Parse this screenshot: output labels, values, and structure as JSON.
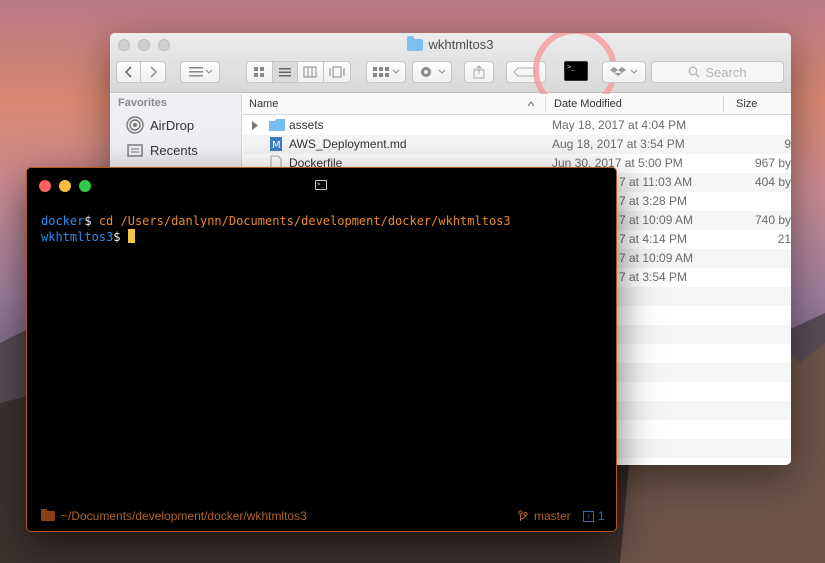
{
  "finder": {
    "title": "wkhtmltos3",
    "search_placeholder": "Search",
    "sidebar": {
      "heading": "Favorites",
      "items": [
        {
          "label": "AirDrop",
          "icon": "airdrop-icon"
        },
        {
          "label": "Recents",
          "icon": "recents-icon"
        }
      ]
    },
    "columns": {
      "name": "Name",
      "date": "Date Modified",
      "size": "Size"
    },
    "rows": [
      {
        "name": "assets",
        "date": "May 18, 2017 at 4:04 PM",
        "size": ""
      },
      {
        "name": "AWS_Deployment.md",
        "date": "Aug 18, 2017 at 3:54 PM",
        "size": "9"
      },
      {
        "name": "Dockerfile",
        "date": "Jun 30, 2017 at 5:00 PM",
        "size": "967 by"
      },
      {
        "name": "",
        "date": "7 at 11:03 AM",
        "size": "404 by"
      },
      {
        "name": "",
        "date": "7 at 3:28 PM",
        "size": ""
      },
      {
        "name": "",
        "date": "7 at 10:09 AM",
        "size": "740 by"
      },
      {
        "name": "",
        "date": "7 at 4:14 PM",
        "size": "21"
      },
      {
        "name": "",
        "date": "7 at 10:09 AM",
        "size": ""
      },
      {
        "name": "",
        "date": "7 at 3:54 PM",
        "size": ""
      }
    ]
  },
  "terminal": {
    "line1_dir": "docker",
    "line1_sym": "$",
    "line1_cmd": "cd /Users/danlynn/Documents/development/docker/wkhtmltos3",
    "line2_dir": "wkhtmltos3",
    "line2_sym": "$",
    "status_path": "~/Documents/development/docker/wkhtmltos3",
    "status_branch": "master",
    "status_ahead": "1"
  },
  "colors": {
    "prompt_blue": "#2d8cf0",
    "command_orange": "#e88a2d",
    "cursor_yellow": "#f7c24a",
    "terminal_border": "#b25a1d",
    "highlight_ring": "#f5969b"
  }
}
